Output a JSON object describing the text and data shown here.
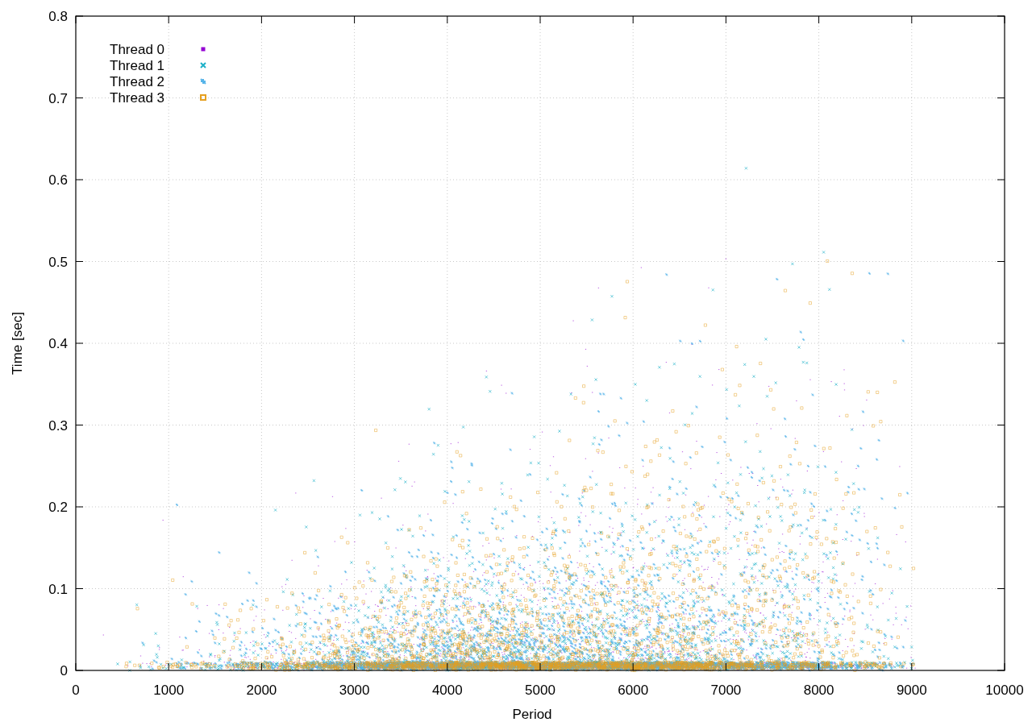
{
  "chart": {
    "xlabel": "Period",
    "ylabel": "Time [sec]",
    "xticks": [
      "0",
      "1000",
      "2000",
      "3000",
      "4000",
      "5000",
      "6000",
      "7000",
      "8000",
      "9000",
      "10000"
    ],
    "yticks": [
      "0.8",
      "0.7",
      "0.6",
      "0.5",
      "0.4",
      "0.3",
      "0.2",
      "0.1",
      "0"
    ],
    "legend": [
      {
        "label": "Thread 0",
        "kind": "dot",
        "color": "#9400d3"
      },
      {
        "label": "Thread 1",
        "kind": "cross",
        "color": "#1cb0c8"
      },
      {
        "label": "Thread 2",
        "kind": "star",
        "color": "#56b4e9"
      },
      {
        "label": "Thread 3",
        "kind": "square",
        "color": "#e6a020"
      }
    ]
  }
}
